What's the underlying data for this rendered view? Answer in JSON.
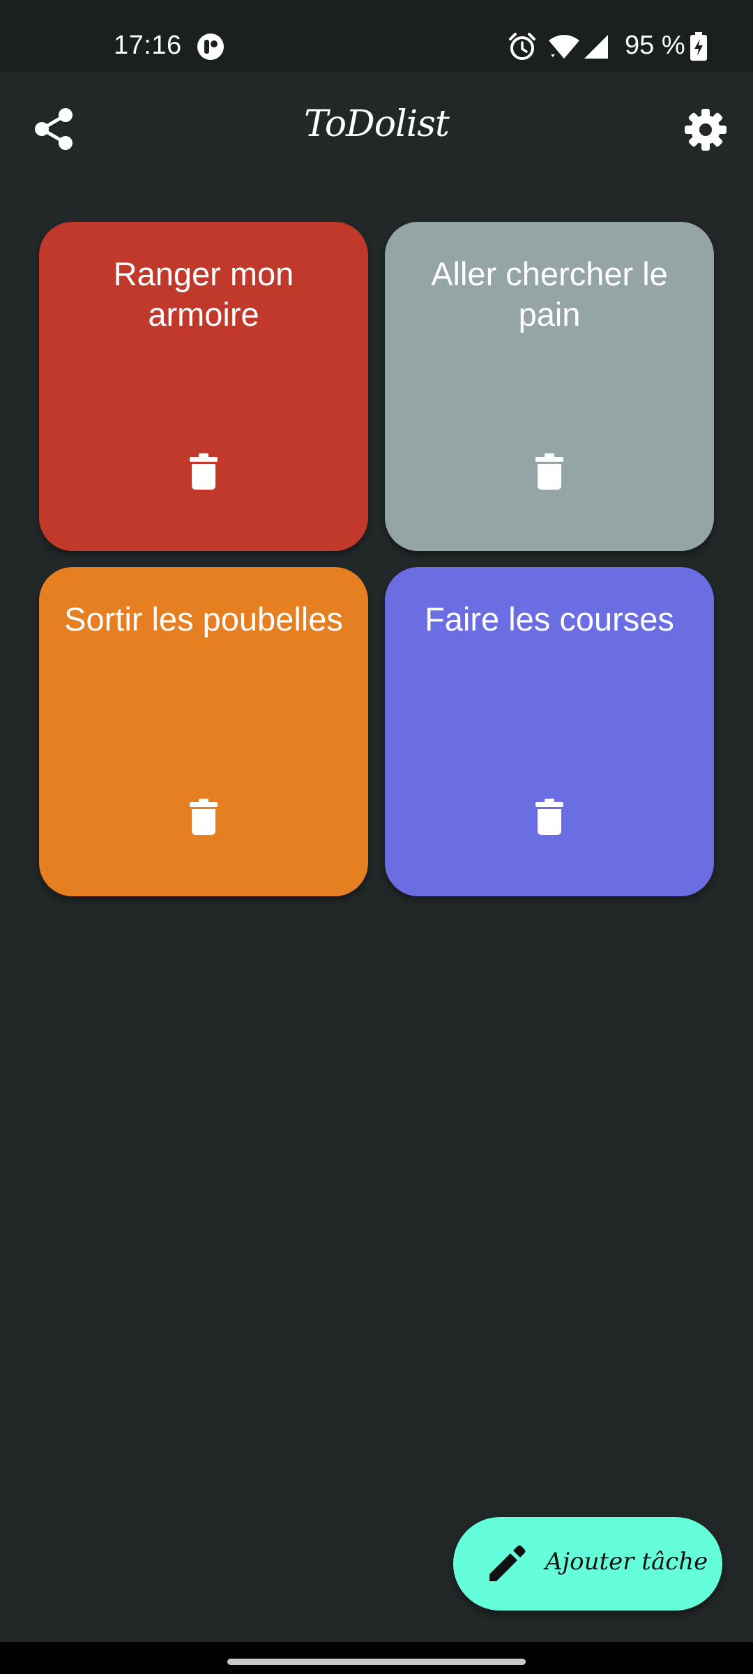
{
  "status_bar": {
    "time": "17:16",
    "battery": "95 %",
    "icons": [
      "app-notification-icon",
      "alarm-icon",
      "wifi-icon",
      "signal-icon",
      "battery-charging-icon"
    ]
  },
  "app_bar": {
    "title": "ToDolist",
    "share_icon": "share-icon",
    "settings_icon": "gear-icon"
  },
  "tasks": [
    {
      "title": "Ranger mon armoire",
      "color": "#c0392b",
      "delete_icon": "trash-icon"
    },
    {
      "title": "Aller chercher le pain",
      "color": "#95a5a6",
      "delete_icon": "trash-icon"
    },
    {
      "title": "Sortir les poubelles",
      "color": "#e67e22",
      "delete_icon": "trash-icon"
    },
    {
      "title": "Faire les courses",
      "color": "#6a6ee2",
      "delete_icon": "trash-icon"
    }
  ],
  "fab": {
    "label": "Ajouter tâche",
    "icon": "pencil-icon",
    "color": "#64ffda"
  },
  "theme": {
    "background": "#222728",
    "status_bar": "#1b1f20"
  }
}
